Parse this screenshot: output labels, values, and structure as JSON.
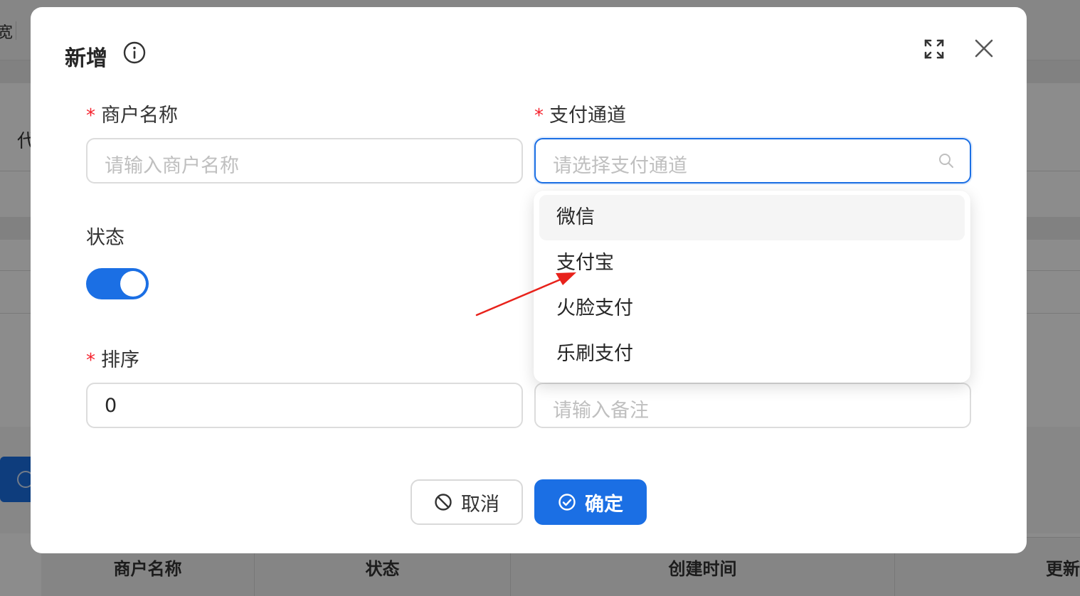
{
  "background": {
    "top_fragment": "宽",
    "left_fragment": "代",
    "table_headers": [
      "商户名称",
      "状态",
      "创建时间",
      "更新"
    ]
  },
  "modal": {
    "title": "新增",
    "fields": {
      "merchant_name": {
        "label": "商户名称",
        "required": true,
        "placeholder": "请输入商户名称"
      },
      "payment_channel": {
        "label": "支付通道",
        "required": true,
        "placeholder": "请选择支付通道"
      },
      "status": {
        "label": "状态",
        "enabled": true
      },
      "sort": {
        "label": "排序",
        "required": true,
        "value": "0"
      },
      "remark": {
        "placeholder": "请输入备注"
      }
    },
    "dropdown_options": [
      "微信",
      "支付宝",
      "火脸支付",
      "乐刷支付"
    ],
    "buttons": {
      "cancel": "取消",
      "ok": "确定"
    }
  },
  "colors": {
    "primary": "#1b6fe4",
    "required": "#f5222d",
    "annotation_arrow": "#e8221b"
  }
}
